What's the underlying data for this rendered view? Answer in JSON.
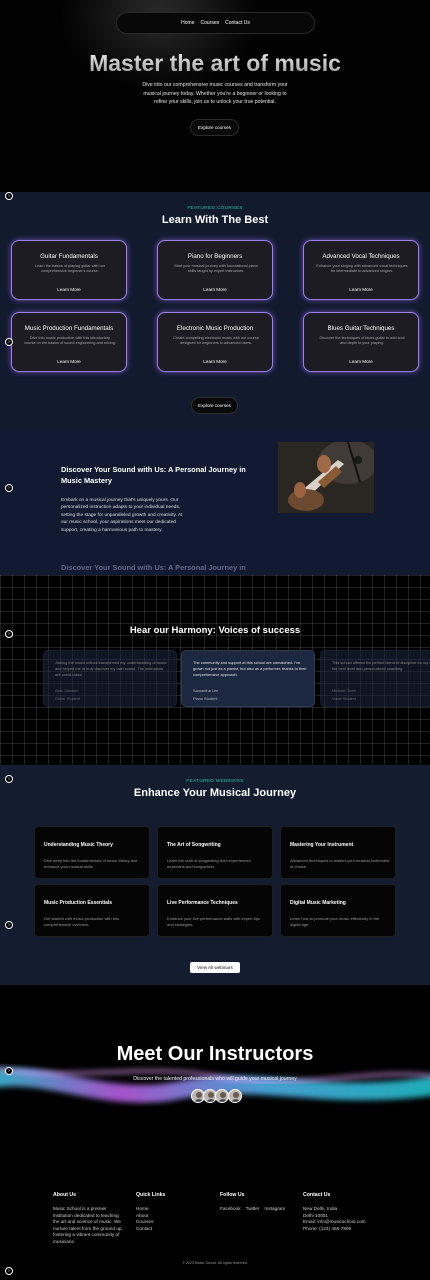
{
  "nav": {
    "items": [
      "Home",
      "Courses",
      "Contact Us"
    ]
  },
  "hero": {
    "title": "Master the art of music",
    "subtitle": "Dive into our comprehensive music courses and transform your musical journey today. Whether you're a beginner or looking to refine your skills, join us to unlock your true potential.",
    "cta": "Explore courses"
  },
  "side_dot_icon": "›",
  "courses": {
    "kicker": "FEATURED COURSES",
    "title": "Learn With The Best",
    "items": [
      {
        "title": "Guitar Fundamentals",
        "desc": "Learn the basics of playing guitar with our comprehensive beginner's course.",
        "link": "Learn More"
      },
      {
        "title": "Piano for Beginners",
        "desc": "Start your musical journey with foundational piano skills taught by expert instructors.",
        "link": "Learn More"
      },
      {
        "title": "Advanced Vocal Techniques",
        "desc": "Enhance your singing with advanced vocal techniques for intermediate to advanced singers.",
        "link": "Learn More"
      },
      {
        "title": "Music Production Fundamentals",
        "desc": "Dive into music production with this introductory course on the basics of sound engineering and mixing.",
        "link": "Learn More"
      },
      {
        "title": "Electronic Music Production",
        "desc": "Create compelling electronic music with our course designed for beginners to advanced users.",
        "link": "Learn More"
      },
      {
        "title": "Blues Guitar Techniques",
        "desc": "Discover the techniques of blues guitar to add soul and depth to your playing.",
        "link": "Learn More"
      }
    ],
    "cta": "Explore courses"
  },
  "discover": {
    "title": "Discover Your Sound with Us: A Personal Journey in Music Mastery",
    "body": "Embark on a musical journey that's uniquely yours. Our personalized instruction adapts to your individual needs, setting the stage for unparalleled growth and creativity. At our music school, your aspirations meet our dedicated support, creating a harmonious path to mastery.",
    "next_title": "Discover Your Sound with Us: A Personal Journey in"
  },
  "testimonials": {
    "title": "Hear our Harmony: Voices of success",
    "items": [
      {
        "quote": "Joining the music school transformed my understanding of music and helped me to truly discover my own sound. The instructors are world-class!",
        "name": "Alex Johnson",
        "role": "Guitar Student"
      },
      {
        "quote": "The community and support at this school are unmatched. I've grown not just as a pianist, but also as a performer, thanks to their comprehensive approach.",
        "name": "Samantha Lee",
        "role": "Piano Student"
      },
      {
        "quote": "This school offered the perfect blend of discipline for my singing to the next level and personalized coaching.",
        "name": "Michael Chen",
        "role": "Vocal Student"
      }
    ]
  },
  "webinars": {
    "kicker": "FEATURED WEBINARS",
    "title": "Enhance Your Musical Journey",
    "items": [
      {
        "title": "Understanding Music Theory",
        "desc": "Dive deep into the fundamentals of music theory and enhance your musical skills."
      },
      {
        "title": "The Art of Songwriting",
        "desc": "Learn the craft of songwriting from experienced musicians and songwriters."
      },
      {
        "title": "Mastering Your Instrument",
        "desc": "Advanced techniques to master your musical instrument of choice."
      },
      {
        "title": "Music Production Essentials",
        "desc": "Get started with music production with this comprehensive overview."
      },
      {
        "title": "Live Performance Techniques",
        "desc": "Enhance your live performance skills with expert tips and strategies."
      },
      {
        "title": "Digital Music Marketing",
        "desc": "Learn how to promote your music effectively in the digital age."
      }
    ],
    "cta": "View All webinars"
  },
  "instructors": {
    "title": "Meet Our Instructors",
    "subtitle": "Discover the talented professionals who will guide your musical journey"
  },
  "footer": {
    "about": {
      "heading": "About Us",
      "text": "Music School is a premier institution dedicated to teaching the art and science of music. We nurture talent from the ground up, fostering a vibrant community of musicians."
    },
    "quick_links": {
      "heading": "Quick Links",
      "items": [
        "Home",
        "About",
        "Courses",
        "Contact"
      ]
    },
    "follow": {
      "heading": "Follow Us",
      "items": [
        "Facebook",
        "Twitter",
        "Instagram"
      ]
    },
    "contact": {
      "heading": "Contact Us",
      "lines": [
        "New Delhi, India",
        "Delhi 10001",
        "Email: info@musicschool.com",
        "Phone: (123) 456-7890"
      ]
    },
    "copyright": "© 2023 Music School. All rights reserved."
  }
}
